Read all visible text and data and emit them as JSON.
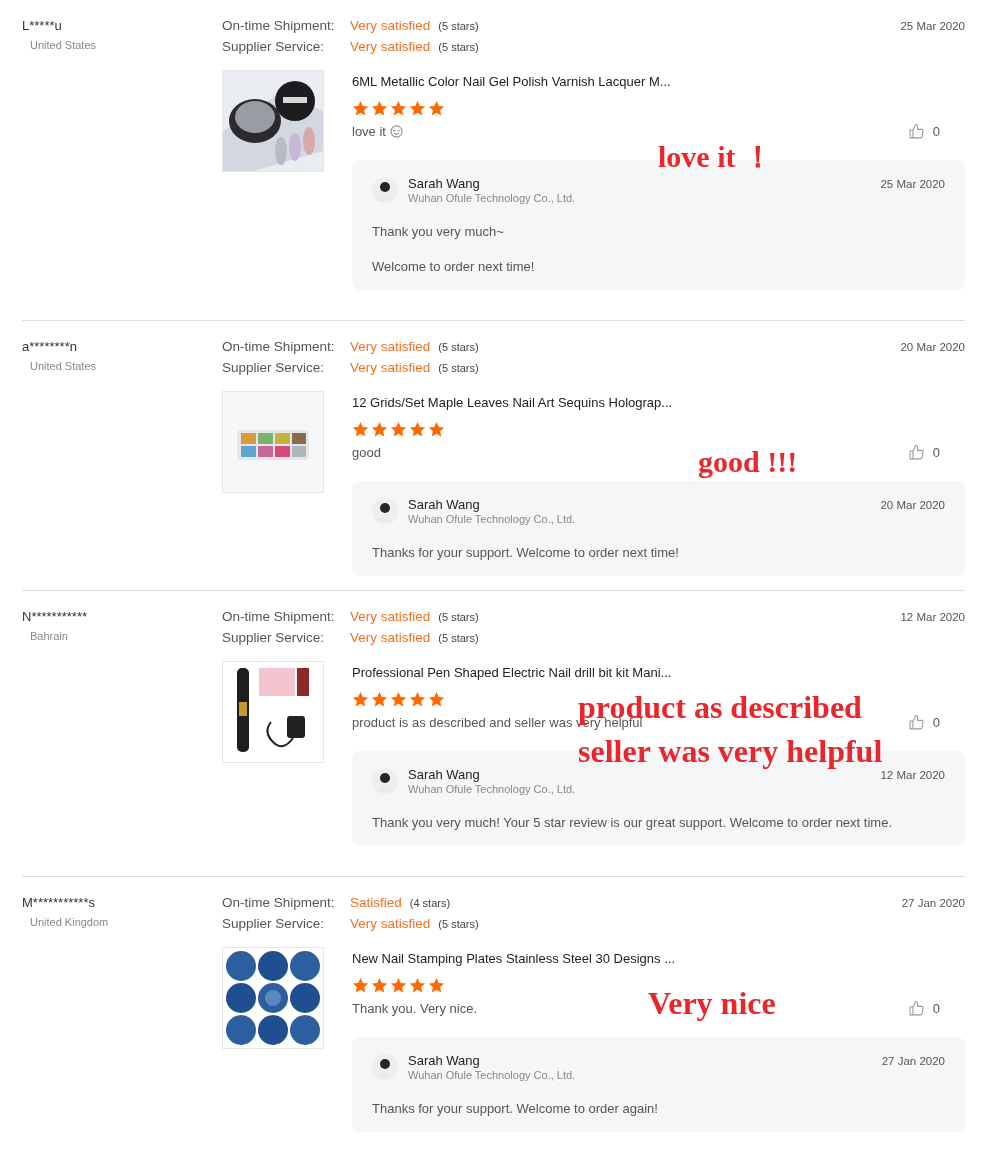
{
  "reviews": [
    {
      "user": "L*****u",
      "country": "United States",
      "date": "25 Mar 2020",
      "ratings": [
        {
          "label": "On-time Shipment:",
          "verdict": "Very satisfied",
          "stars_text": "(5 stars)"
        },
        {
          "label": "Supplier Service:",
          "verdict": "Very satisfied",
          "stars_text": "(5 stars)"
        }
      ],
      "product": {
        "title": "6ML Metallic Color Nail Gel Polish Varnish Lacquer M...",
        "kind": "jar"
      },
      "stars": 5,
      "comment": "love it",
      "emoji": true,
      "likes": "0",
      "reply": {
        "name": "Sarah Wang",
        "company": "Wuhan Ofule Technology Co., Ltd.",
        "date": "25 Mar 2020",
        "paragraphs": [
          "Thank you very much~",
          "Welcome to order next time!"
        ]
      },
      "annotation": [
        "love it ！"
      ]
    },
    {
      "user": "a********n",
      "country": "United States",
      "date": "20 Mar 2020",
      "ratings": [
        {
          "label": "On-time Shipment:",
          "verdict": "Very satisfied",
          "stars_text": "(5 stars)"
        },
        {
          "label": "Supplier Service:",
          "verdict": "Very satisfied",
          "stars_text": "(5 stars)"
        }
      ],
      "product": {
        "title": "12 Grids/Set Maple Leaves Nail Art Sequins Holograp...",
        "kind": "sequins"
      },
      "stars": 5,
      "comment": "good",
      "emoji": false,
      "likes": "0",
      "reply": {
        "name": "Sarah Wang",
        "company": "Wuhan Ofule Technology Co., Ltd.",
        "date": "20 Mar 2020",
        "paragraphs": [
          "Thanks for your support. Welcome to order next time!"
        ]
      },
      "annotation": [
        "good !!!"
      ]
    },
    {
      "user": "N***********",
      "country": "Bahrain",
      "date": "12 Mar 2020",
      "ratings": [
        {
          "label": "On-time Shipment:",
          "verdict": "Very satisfied",
          "stars_text": "(5 stars)"
        },
        {
          "label": "Supplier Service:",
          "verdict": "Very satisfied",
          "stars_text": "(5 stars)"
        }
      ],
      "product": {
        "title": "Professional Pen Shaped Electric Nail drill bit kit Mani...",
        "kind": "drill"
      },
      "stars": 5,
      "comment": "product is as described and seller was very helpful",
      "emoji": false,
      "likes": "0",
      "reply": {
        "name": "Sarah Wang",
        "company": "Wuhan Ofule Technology Co., Ltd.",
        "date": "12 Mar 2020",
        "paragraphs": [
          "Thank you very much! Your 5 star review is our great support. Welcome to order next time."
        ]
      },
      "annotation": [
        "product as described",
        "seller was very helpful"
      ]
    },
    {
      "user": "M***********s",
      "country": "United Kingdom",
      "date": "27 Jan 2020",
      "ratings": [
        {
          "label": "On-time Shipment:",
          "verdict": "Satisfied",
          "stars_text": "(4 stars)"
        },
        {
          "label": "Supplier Service:",
          "verdict": "Very satisfied",
          "stars_text": "(5 stars)"
        }
      ],
      "product": {
        "title": "New Nail Stamping Plates Stainless Steel 30 Designs ...",
        "kind": "plates"
      },
      "stars": 5,
      "comment": "Thank you. Very nice.",
      "emoji": false,
      "likes": "0",
      "reply": {
        "name": "Sarah Wang",
        "company": "Wuhan Ofule Technology Co., Ltd.",
        "date": "27 Jan 2020",
        "paragraphs": [
          "Thanks for your support. Welcome to order again!"
        ]
      },
      "annotation": [
        "Very nice"
      ]
    }
  ]
}
